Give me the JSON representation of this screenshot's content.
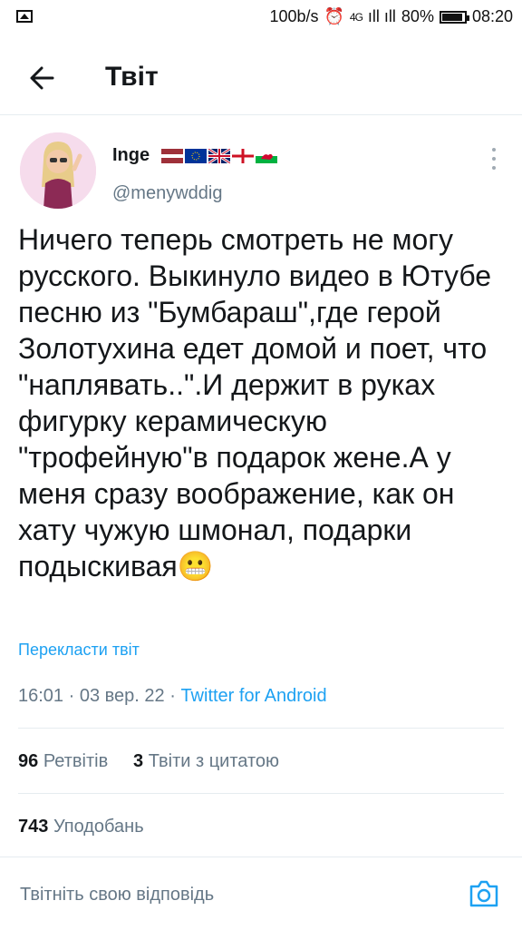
{
  "status_bar": {
    "speed": "100b/s",
    "network": "4G",
    "battery": "80%",
    "time": "08:20"
  },
  "header": {
    "title": "Твіт"
  },
  "tweet": {
    "display_name": "Inge",
    "handle": "@menywddig",
    "text": "Ничего теперь смотреть не могу русского. Выкинуло видео в Ютубе песню из \"Бумбараш\",где герой Золотухина едет домой и поет, что \"наплявать..\".И держит в руках фигурку керамическую \"трофейную\"в подарок жене.А у меня сразу воображение, как он хату чужую шмонал, подарки подыскивая",
    "emoji": "😬",
    "translate_label": "Перекласти твіт",
    "time": "16:01",
    "date": "03 вер. 22",
    "source": "Twitter for Android"
  },
  "stats": {
    "retweets_count": "96",
    "retweets_label": "Ретвітів",
    "quotes_count": "3",
    "quotes_label": "Твіти з цитатою",
    "likes_count": "743",
    "likes_label": "Уподобань"
  },
  "reply": {
    "placeholder": "Твітніть свою відповідь"
  },
  "colors": {
    "accent": "#1da1f2",
    "secondary_text": "#657786",
    "divider": "#e6ecf0"
  }
}
